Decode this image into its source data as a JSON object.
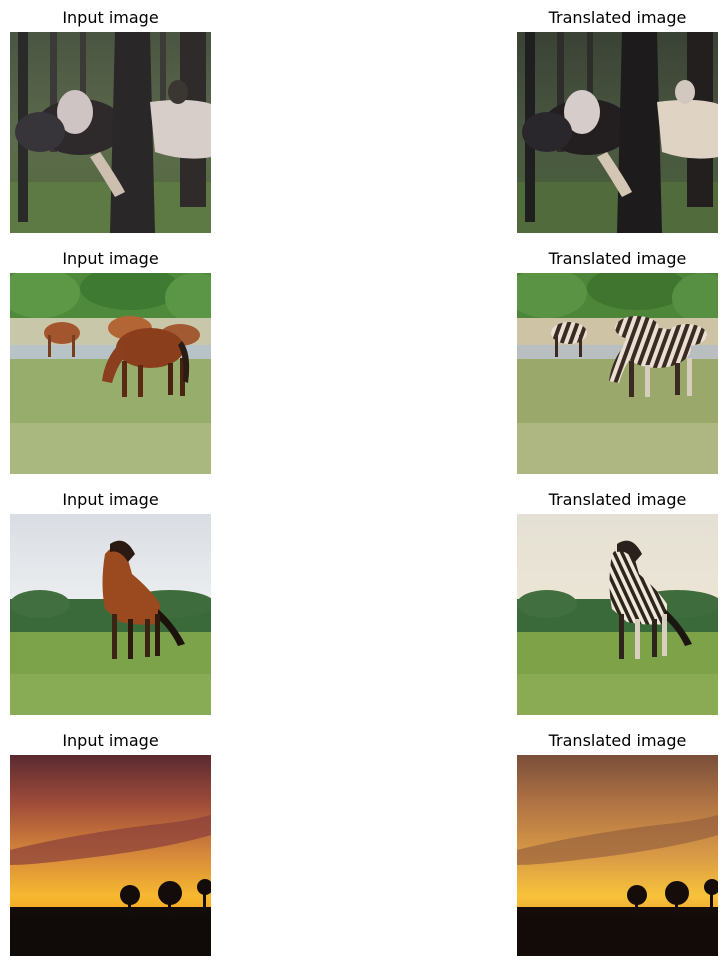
{
  "rows": [
    {
      "input": {
        "title": "Input image",
        "scene": "horses-in-forest"
      },
      "output": {
        "title": "Translated image",
        "scene": "horses-in-forest-translated"
      }
    },
    {
      "input": {
        "title": "Input image",
        "scene": "horses-grazing-meadow"
      },
      "output": {
        "title": "Translated image",
        "scene": "zebra-striped-horses-meadow"
      }
    },
    {
      "input": {
        "title": "Input image",
        "scene": "galloping-horse-field"
      },
      "output": {
        "title": "Translated image",
        "scene": "galloping-zebra-field"
      }
    },
    {
      "input": {
        "title": "Input image",
        "scene": "sunset-treeline"
      },
      "output": {
        "title": "Translated image",
        "scene": "sunset-treeline-translated"
      }
    }
  ]
}
